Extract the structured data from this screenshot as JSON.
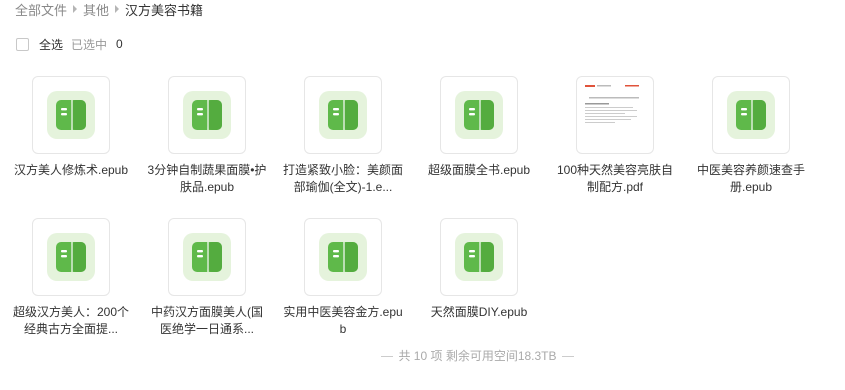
{
  "breadcrumb": [
    "全部文件",
    "其他",
    "汉方美容书籍"
  ],
  "selection": {
    "select_all_label": "全选",
    "selected_label": "已选中",
    "selected_count": "0"
  },
  "files": [
    {
      "name": "汉方美人修炼术.epub",
      "type": "epub"
    },
    {
      "name": "3分钟自制蔬果面膜•护肤品.epub",
      "type": "epub"
    },
    {
      "name": "打造紧致小脸：美颜面部瑜伽(全文)-1.e...",
      "type": "epub"
    },
    {
      "name": "超级面膜全书.epub",
      "type": "epub"
    },
    {
      "name": "100种天然美容亮肤自制配方.pdf",
      "type": "pdf"
    },
    {
      "name": "中医美容养颜速查手册.epub",
      "type": "epub"
    },
    {
      "name": "超级汉方美人：200个经典古方全面提...",
      "type": "epub"
    },
    {
      "name": "中药汉方面膜美人(国医绝学一日通系...",
      "type": "epub"
    },
    {
      "name": "实用中医美容金方.epub",
      "type": "epub"
    },
    {
      "name": "天然面膜DIY.epub",
      "type": "epub"
    }
  ],
  "footer": {
    "text": "共 10 项 剩余可用空间18.3TB"
  },
  "colors": {
    "epub_bg": "#e5f3dc",
    "epub_book": "#5fb94a",
    "epub_book_dark": "#4aa337"
  }
}
